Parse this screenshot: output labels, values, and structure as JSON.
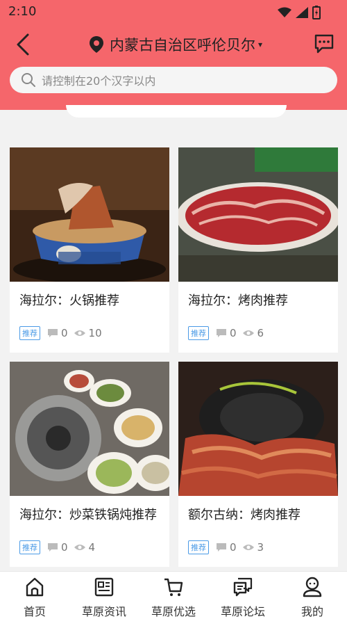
{
  "status": {
    "time": "2:10"
  },
  "header": {
    "location": "内蒙古自治区呼伦贝尔",
    "location_caret": "▾"
  },
  "search": {
    "placeholder": "请控制在20个汉字以内"
  },
  "colors": {
    "header_bg": "#f5666b",
    "tag": "#4a9ae6"
  },
  "cards": [
    {
      "title": "海拉尔：火锅推荐",
      "tag": "推荐",
      "comments": "0",
      "views": "10",
      "image": "hotpot-photo"
    },
    {
      "title": "海拉尔：烤肉推荐",
      "tag": "推荐",
      "comments": "0",
      "views": "6",
      "image": "raw-meat-photo"
    },
    {
      "title": "海拉尔：炒菜铁锅炖推荐",
      "tag": "推荐",
      "comments": "0",
      "views": "4",
      "image": "stir-fry-photo"
    },
    {
      "title": "额尔古纳：烤肉推荐",
      "tag": "推荐",
      "comments": "0",
      "views": "3",
      "image": "grill-photo"
    }
  ],
  "nav": [
    {
      "label": "首页",
      "icon": "home-icon"
    },
    {
      "label": "草原资讯",
      "icon": "news-icon"
    },
    {
      "label": "草原优选",
      "icon": "cart-icon"
    },
    {
      "label": "草原论坛",
      "icon": "forum-icon"
    },
    {
      "label": "我的",
      "icon": "profile-icon"
    }
  ]
}
